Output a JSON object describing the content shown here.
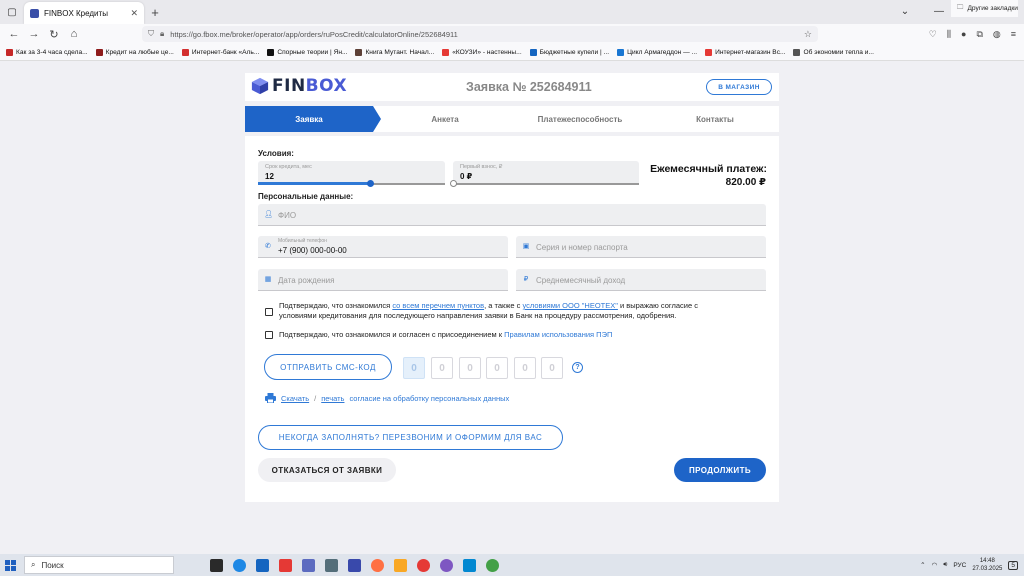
{
  "browser": {
    "tab_title": "FINBOX Кредиты",
    "url": "https://go.fbox.me/broker/operator/app/orders/ruPosCredit/calculatorOnline/252684911",
    "bookmarks": [
      {
        "label": "Как за 3-4 часа сдела...",
        "color": "#c62828"
      },
      {
        "label": "Кредит на любые це...",
        "color": "#8e1b1b"
      },
      {
        "label": "Интернет-банк «Аль...",
        "color": "#d32f2f"
      },
      {
        "label": "Спорные теории | Ян...",
        "color": "#111111"
      },
      {
        "label": "Книга Мутант. Начал...",
        "color": "#5d4037"
      },
      {
        "label": "«КОУЗИ» - настенны...",
        "color": "#e53935"
      },
      {
        "label": "Бюджетные купели | ...",
        "color": "#1565c0"
      },
      {
        "label": "Цикл Армагеддон — ...",
        "color": "#1976d2"
      },
      {
        "label": "Интернет-магазин Вс...",
        "color": "#e53935"
      },
      {
        "label": "Об экономии тепла и...",
        "color": "#555555"
      }
    ],
    "other_bookmarks": "Другие закладки"
  },
  "header": {
    "logo_fin": "FIN",
    "logo_box": "BOX",
    "order_title": "Заявка № 252684911",
    "shop_button": "В МАГАЗИН"
  },
  "steps": [
    "Заявка",
    "Анкета",
    "Платежеспособность",
    "Контакты"
  ],
  "conditions": {
    "label": "Условия:",
    "term_label": "Срок кредита, мес",
    "term_value": "12",
    "term_fraction": 0.6,
    "down_label": "Первый взнос, ₽",
    "down_value": "0 ₽",
    "down_fraction": 0.0,
    "monthly_label": "Ежемесячный платеж:",
    "monthly_value": "820.00 ₽"
  },
  "personal": {
    "label": "Персональные данные:",
    "fio_placeholder": "ФИО",
    "phone_label": "Мобильный телефон",
    "phone_value": "+7 (900) 000-00-00",
    "passport_placeholder": "Серия и номер паспорта",
    "birth_placeholder": "Дата рождения",
    "income_placeholder": "Среднемесячный доход"
  },
  "consents": {
    "c1_a": "Подтверждаю, что ознакомился ",
    "c1_link1": "со всем перечнем пунктов",
    "c1_b": ", а также с ",
    "c1_link2": "условиями ООО \"НЕОТЕХ\"",
    "c1_c": " и выражаю согласие с",
    "c1_line2": "условиями кредитования для последующего направления заявки в Банк на процедуру рассмотрения, одобрения.",
    "c2_a": "Подтверждаю, что ознакомился и согласен с присоединением к ",
    "c2_link": "Правилам использования ПЭП"
  },
  "sms": {
    "button": "ОТПРАВИТЬ СМС-КОД",
    "digits": [
      "0",
      "0",
      "0",
      "0",
      "0",
      "0"
    ],
    "help": "?"
  },
  "download": {
    "download_link": "Скачать",
    "slash": "/",
    "print_link": "печать",
    "rest": "согласие на обработку персональных данных"
  },
  "actions": {
    "callback": "НЕКОГДА ЗАПОЛНЯТЬ? ПЕРЕЗВОНИМ И ОФОРМИМ ДЛЯ ВАС",
    "refuse": "ОТКАЗАТЬСЯ ОТ ЗАЯВКИ",
    "continue": "ПРОДОЛЖИТЬ"
  },
  "taskbar": {
    "search": "Поиск",
    "lang": "РУС",
    "time": "14:48",
    "date": "27.03.2025",
    "notifications": "5"
  },
  "colors": {
    "accent": "#1e64c8",
    "link": "#2f79d6"
  }
}
